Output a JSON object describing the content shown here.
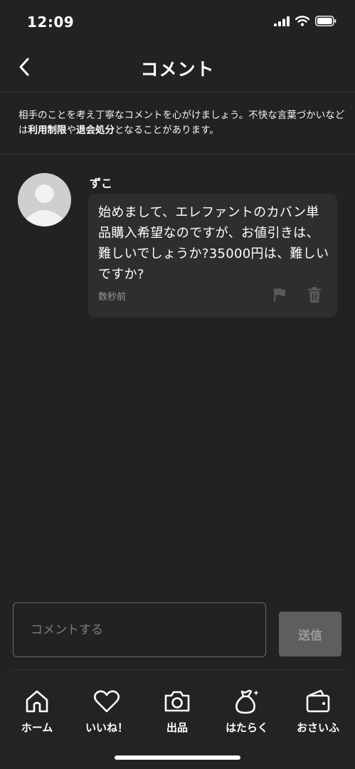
{
  "status_bar": {
    "time": "12:09"
  },
  "nav": {
    "title": "コメント"
  },
  "notice": {
    "text_1": "相手のことを考え丁寧なコメントを心がけましょう。不快な言葉づかいなどは",
    "bold_1": "利用制限",
    "text_2": "や",
    "bold_2": "退会処分",
    "text_3": "となることがあります。"
  },
  "comment": {
    "user": "ずこ",
    "text": "始めまして、エレファントのカバン単品購入希望なのですが、お値引きは、難しいでしょうか?35000円は、難しいですか?",
    "time": "数秒前"
  },
  "composer": {
    "placeholder": "コメントする",
    "send_label": "送信"
  },
  "tabs": [
    {
      "label": "ホーム",
      "icon": "home-icon"
    },
    {
      "label": "いいね！",
      "icon": "heart-icon"
    },
    {
      "label": "出品",
      "icon": "camera-icon"
    },
    {
      "label": "はたらく",
      "icon": "money-bag-icon"
    },
    {
      "label": "おさいふ",
      "icon": "wallet-icon"
    }
  ],
  "colors": {
    "background": "#222222",
    "bubble": "#2e2e2e",
    "send_button": "#5e5e5e"
  }
}
